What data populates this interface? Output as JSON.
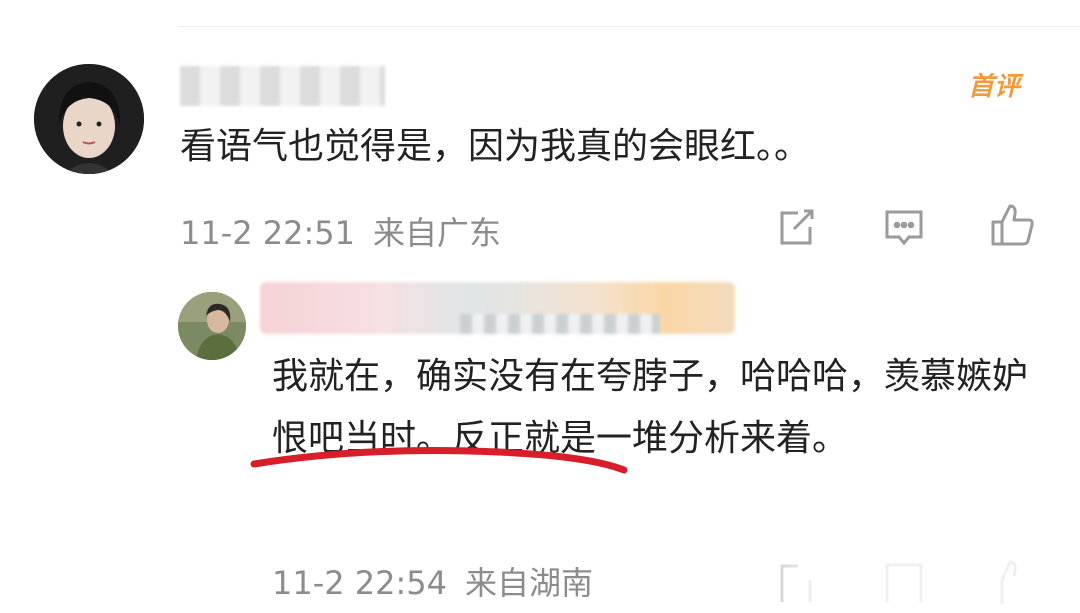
{
  "comments": [
    {
      "text": "看语气也觉得是，因为我真的会眼红。。",
      "badge": "首评",
      "time": "11-2 22:51",
      "location": "来自广东"
    }
  ],
  "reply": {
    "text": "我就在，确实没有在夸脖子，哈哈哈，羡慕嫉妒恨吧当时。反正就是一堆分析来着。",
    "time": "11-2 22:54",
    "location": "来自湖南"
  },
  "colors": {
    "badge": "#f39a3a",
    "meta": "#8c8c8c",
    "text": "#222222",
    "underline_annotation": "#d81e2a"
  },
  "icons": [
    "share-icon",
    "comment-icon",
    "like-icon"
  ]
}
